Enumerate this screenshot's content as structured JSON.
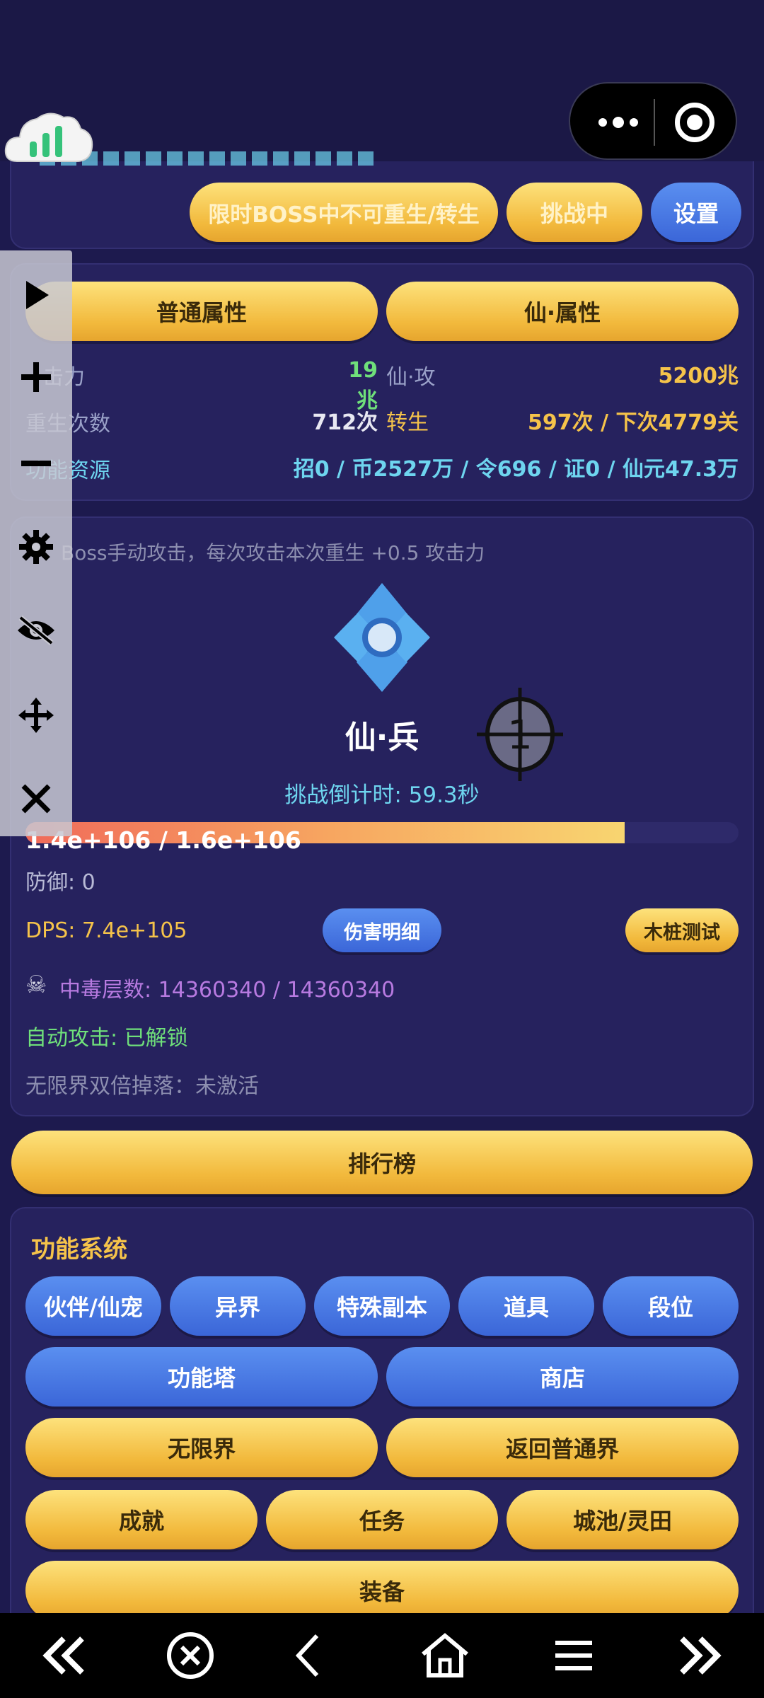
{
  "header": {
    "boss_restriction_label": "限时BOSS中不可重生/转生",
    "challenge_status_label": "挑战中",
    "settings_label": "设置"
  },
  "attributes": {
    "tab_normal": "普通属性",
    "tab_immortal": "仙·属性",
    "attack_label": "击力",
    "attack_value": "19兆",
    "immortal_attack_label": "仙·攻",
    "immortal_attack_value": "5200兆",
    "rebirth_label": "重生次数",
    "rebirth_value": "712次",
    "reincarnation_label": "转生",
    "reincarnation_value": "597次 / 下次4779关",
    "resources_label": "功能资源",
    "resources_value": "招0 / 币2527万 / 令696 / 证0 / 仙元47.3万"
  },
  "boss": {
    "hint": "Boss手动攻击，每次攻击本次重生 +0.5 攻击力",
    "name": "仙·兵",
    "countdown": "挑战倒计时: 59.3秒",
    "hp_text": "1.4e+106 / 1.6e+106",
    "hp_fraction": 0.84,
    "defense": "防御: 0",
    "dps": "DPS: 7.4e+105",
    "damage_detail_label": "伤害明细",
    "dummy_test_label": "木桩测试",
    "poison_stacks": "中毒层数: 14360340 / 14360340",
    "auto_attack": "自动攻击: 已解锁",
    "double_drop": "无限界双倍掉落：未激活",
    "crosshair_number": "1"
  },
  "leaderboard_label": "排行榜",
  "systems": {
    "title": "功能系统",
    "row1": [
      "伙伴/仙宠",
      "异界",
      "特殊副本",
      "道具",
      "段位"
    ],
    "row2": [
      "功能塔",
      "商店"
    ],
    "row3": [
      "无限界",
      "返回普通界"
    ],
    "row4": [
      "成就",
      "任务",
      "城池/灵田"
    ],
    "row5": [
      "装备"
    ]
  },
  "colors": {
    "background": "#1d1a4e",
    "panel": "#26225e",
    "gold": "#f5c34a",
    "blue": "#4a7be4",
    "cyan": "#6ed5ef",
    "green": "#6fe07a",
    "purple": "#b77ae0"
  }
}
